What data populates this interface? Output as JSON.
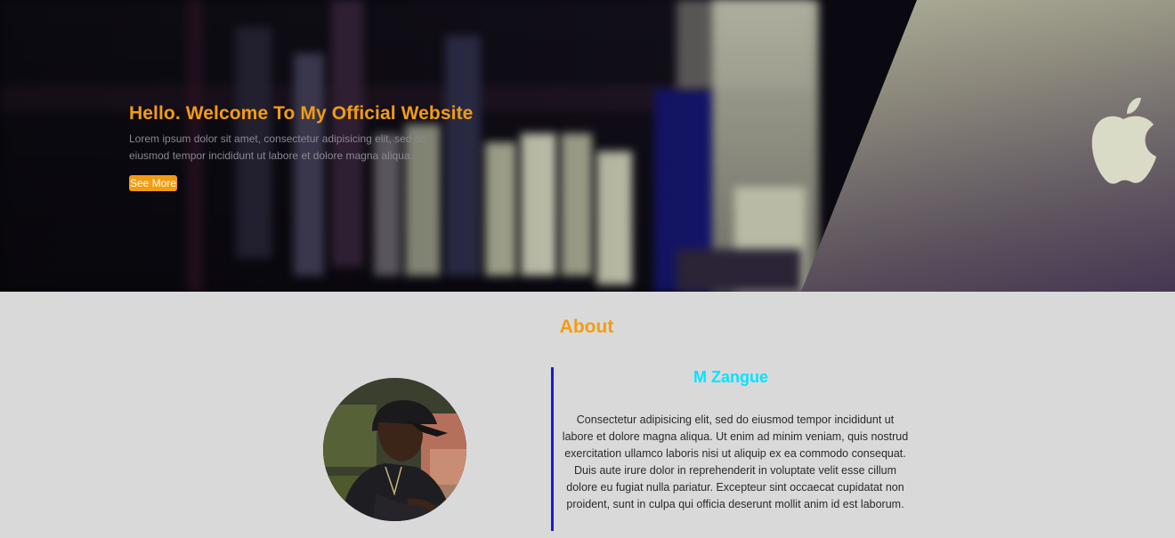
{
  "hero": {
    "title": "Hello. Welcome To My Official Website",
    "text": "Lorem ipsum dolor sit amet, consectetur adipisicing elit, sed do eiusmod tempor incididunt ut labore et dolore magna aliqua.",
    "button_label": "See More"
  },
  "about": {
    "title": "About",
    "name": "M Zangue",
    "bio": "Consectetur adipisicing elit, sed do eiusmod tempor incididunt ut labore et dolore magna aliqua. Ut enim ad minim veniam, quis nostrud exercitation ullamco laboris nisi ut aliquip ex ea commodo consequat. Duis aute irure dolor in reprehenderit in voluptate velit esse cillum dolore eu fugiat nulla pariatur. Excepteur sint occaecat cupidatat non proident, sunt in culpa qui officia deserunt mollit anim id est laborum."
  },
  "colors": {
    "accent": "#f39c12",
    "name": "#00e5ff",
    "divider": "#1a1adb",
    "background": "#d9d9d9"
  },
  "icons": {
    "brand": "apple-logo-icon",
    "avatar": "profile-photo"
  }
}
